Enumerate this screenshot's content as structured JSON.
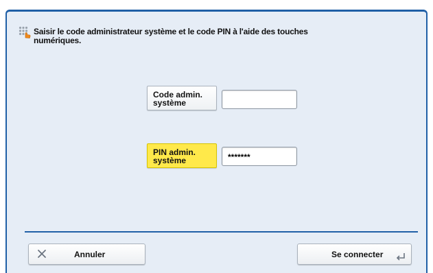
{
  "instruction": {
    "line1": "Saisir le code administrateur système et le code PIN à l'aide des touches",
    "line2": "numériques.",
    "icon": "keypad-hand-icon"
  },
  "fields": {
    "admin_code": {
      "label_line1": "Code admin.",
      "label_line2": "système",
      "value": ""
    },
    "admin_pin": {
      "label_line1": "PIN admin.",
      "label_line2": "système",
      "value": "*******"
    }
  },
  "buttons": {
    "cancel": "Annuler",
    "connect": "Se connecter"
  },
  "colors": {
    "accent": "#1f5fa6",
    "panel_bg": "#e6edf6",
    "active_label": "#ffe94a"
  }
}
